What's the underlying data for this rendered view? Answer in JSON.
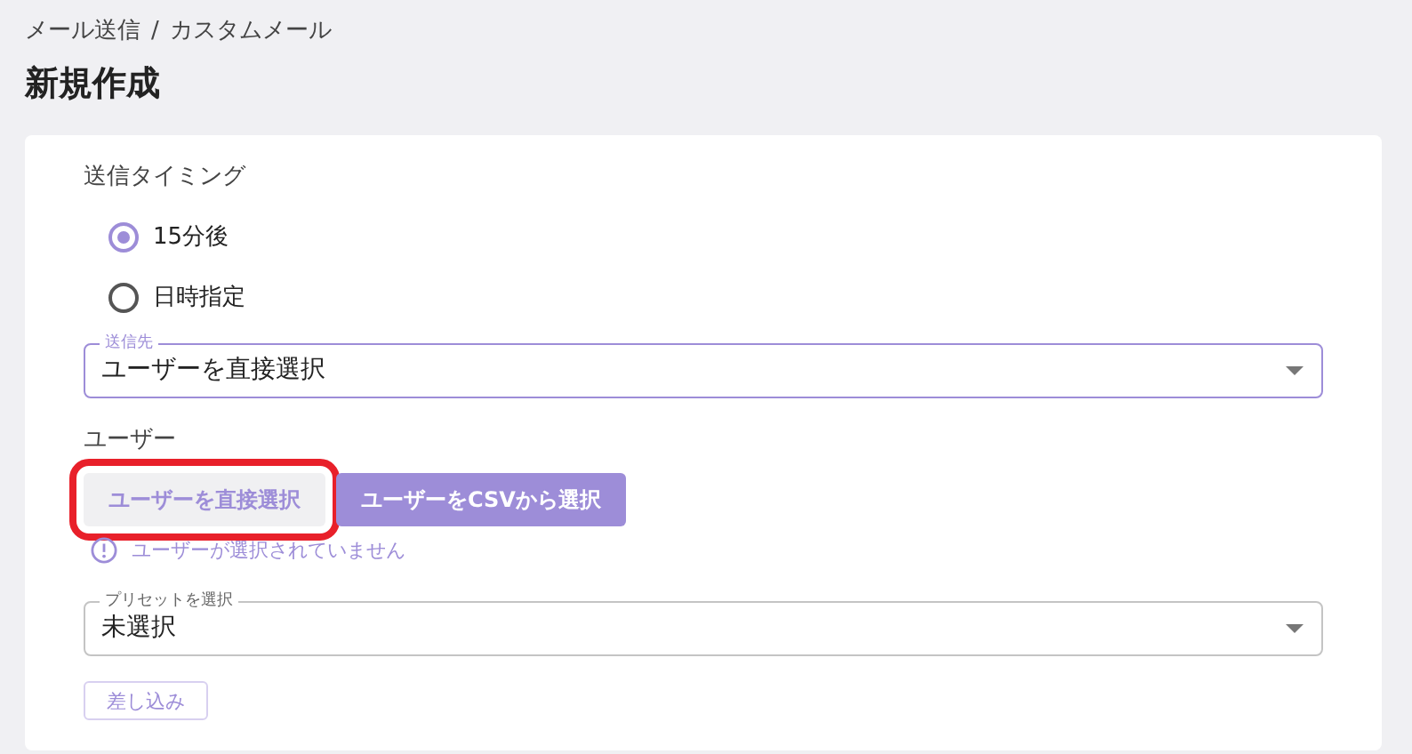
{
  "breadcrumb": {
    "items": [
      "メール送信",
      "カスタムメール"
    ],
    "separator": "/"
  },
  "title": "新規作成",
  "timing": {
    "label": "送信タイミング",
    "options": [
      {
        "label": "15分後",
        "selected": true
      },
      {
        "label": "日時指定",
        "selected": false
      }
    ]
  },
  "recipient": {
    "label": "送信先",
    "value": "ユーザーを直接選択",
    "focused": true
  },
  "users": {
    "label": "ユーザー",
    "buttons": [
      {
        "label": "ユーザーを直接選択",
        "kind": "secondary",
        "highlighted": true
      },
      {
        "label": "ユーザーをCSVから選択",
        "kind": "primary",
        "highlighted": false
      }
    ],
    "error": "ユーザーが選択されていません"
  },
  "preset": {
    "label": "プリセットを選択",
    "value": "未選択",
    "focused": false
  },
  "insert_button": "差し込み"
}
